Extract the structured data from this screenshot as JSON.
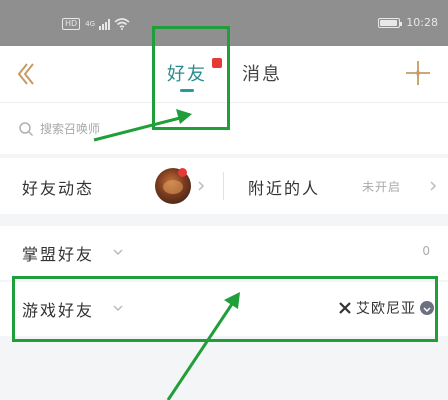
{
  "status_bar": {
    "hd": "HD",
    "network": "4G",
    "battery_level": 0.95,
    "time": "10:28"
  },
  "header": {
    "back_icon": "chevron-left-icon",
    "tabs": [
      {
        "label": "好友",
        "active": true,
        "has_unread_dot": true
      },
      {
        "label": "消息",
        "active": false
      }
    ],
    "plus_icon": "sparkle-plus-icon",
    "accent_color": "#2a8c8c",
    "back_color": "#c79a64"
  },
  "search": {
    "placeholder": "搜索召唤师",
    "icon": "search-icon"
  },
  "activity": {
    "friends_activity": "好友动态",
    "nearby": "附近的人",
    "nearby_status": "未开启"
  },
  "groups": [
    {
      "label": "掌盟好友",
      "count": "0"
    },
    {
      "label": "游戏好友",
      "tag": "艾欧尼亚"
    }
  ],
  "annotation": {
    "highlight_color": "#1f9e3a"
  }
}
